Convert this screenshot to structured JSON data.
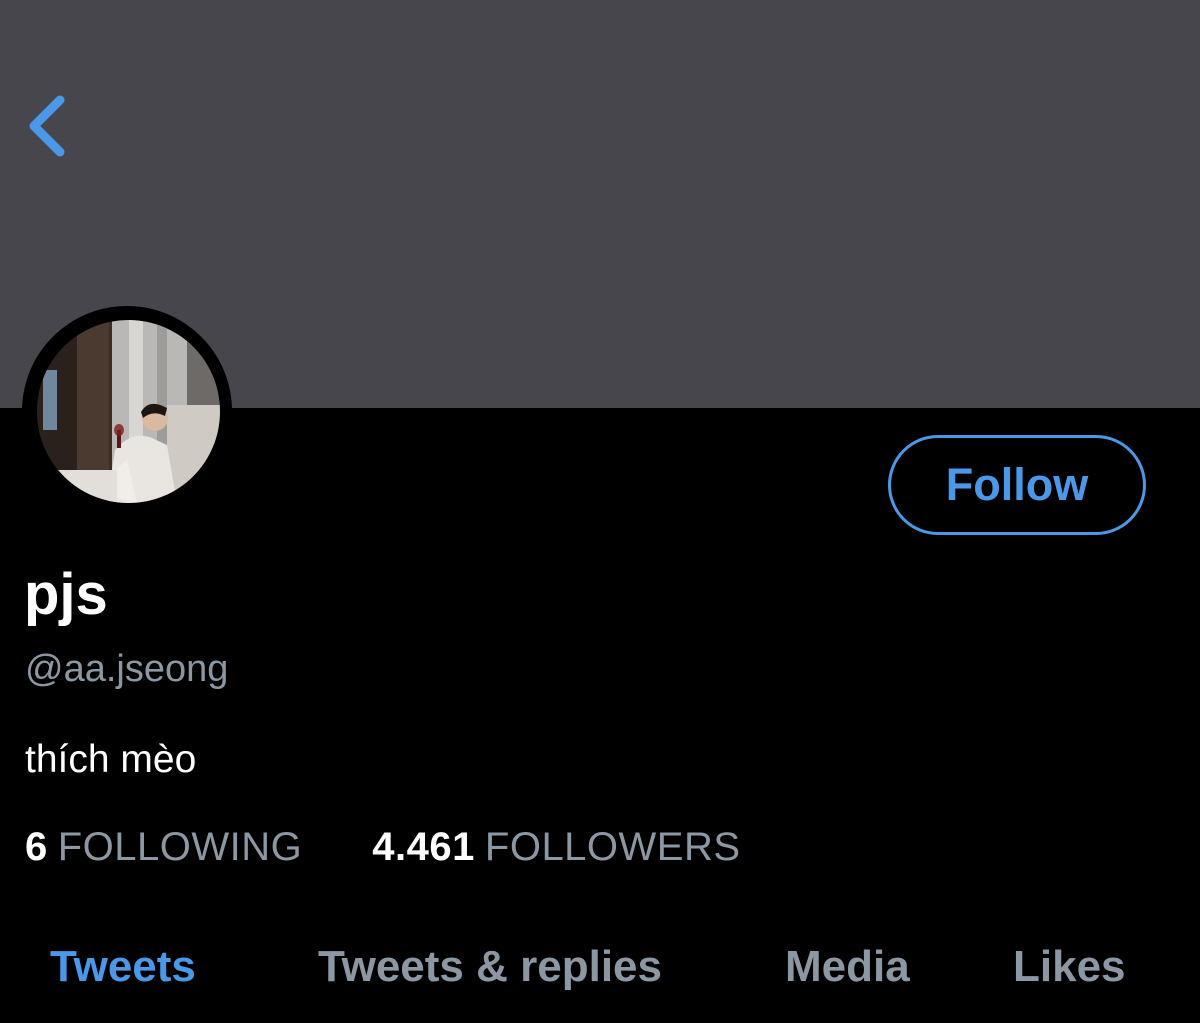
{
  "profile": {
    "display_name": "pjs",
    "handle": "@aa.jseong",
    "bio": "thích mèo"
  },
  "actions": {
    "back_icon": "chevron-left-icon",
    "follow_label": "Follow"
  },
  "stats": {
    "following_count": "6",
    "following_label": "FOLLOWING",
    "followers_count": "4.461",
    "followers_label": "FOLLOWERS"
  },
  "tabs": [
    {
      "label": "Tweets",
      "active": true
    },
    {
      "label": "Tweets & replies",
      "active": false
    },
    {
      "label": "Media",
      "active": false
    },
    {
      "label": "Likes",
      "active": false
    }
  ],
  "colors": {
    "background": "#000000",
    "banner": "#47464d",
    "accent": "#4a99e9",
    "secondary_text": "#8b97a3",
    "primary_text": "#ffffff"
  }
}
